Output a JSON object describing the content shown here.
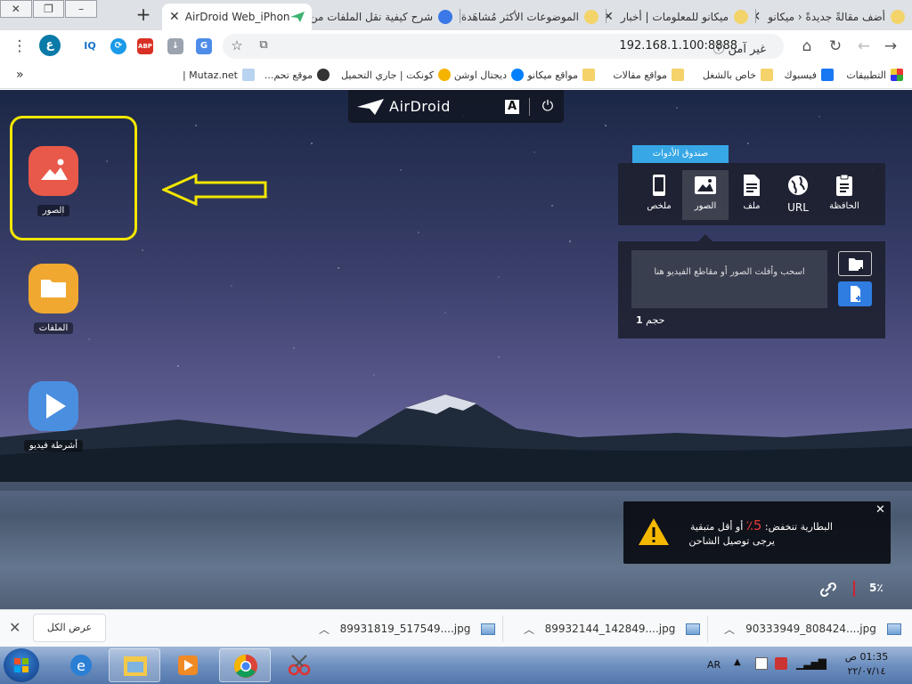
{
  "tabs": [
    {
      "title": "أضف مقالةً جديدةً ‹ ميكانو"
    },
    {
      "title": "ميكانو للمعلومات | أخبار"
    },
    {
      "title": "الموضوعات الأكثر مُشاهَدة"
    },
    {
      "title": "شرح كيفية نقل الملفات من"
    },
    {
      "title": "AirDroid Web_iPhone"
    }
  ],
  "toolbar": {
    "url": "192.168.1.100:8888",
    "security_label": "غير آمن",
    "ext_iq": "IQ",
    "ext_abp": "ABP",
    "ext_profile": "ع"
  },
  "bookmarks": {
    "more": "»",
    "items": [
      {
        "label": "التطبيقات"
      },
      {
        "label": "فيسبوك"
      },
      {
        "label": "خاص بالشغل"
      },
      {
        "label": "مواقع مقالات"
      },
      {
        "label": "مواقع ميكانو"
      },
      {
        "label": "ديجتال اوشن"
      },
      {
        "label": "كونكت | جاري التحميل"
      },
      {
        "label": "موقع تحم..."
      },
      {
        "label": "Mutaz.net |"
      }
    ]
  },
  "airdroid": {
    "brand": "AirDroid",
    "lang_button": "A",
    "apps": [
      {
        "label": "الصور",
        "color": "#e8594a"
      },
      {
        "label": "الملفات",
        "color": "#f0a830"
      },
      {
        "label": "أشرطة فيديو",
        "color": "#4a8ee0"
      }
    ],
    "toolbox": {
      "title": "صندوق الأدوات",
      "tools": [
        {
          "label": "ملخص"
        },
        {
          "label": "الصور"
        },
        {
          "label": "ملف"
        },
        {
          "label": "URL"
        },
        {
          "label": "الحافظة"
        }
      ],
      "drop_text": "اسحب وأفلت الصور أو مقاطع الفيديو هنا",
      "size_label": "حجم",
      "size_value": "1"
    },
    "battery": {
      "line1_prefix": "البطارية تنخفض:",
      "percent": "5٪",
      "line1_suffix": "أو أقل متبقية",
      "line2": "يرجى توصيل الشاحن"
    },
    "bottom_percent": "5٪"
  },
  "downloads": {
    "show_all": "عرض الكل",
    "items": [
      {
        "name": "90333949_808424....jpg"
      },
      {
        "name": "89932144_142849....jpg"
      },
      {
        "name": "89931819_517549....jpg"
      }
    ]
  },
  "taskbar": {
    "language": "AR",
    "time": "01:35 ص",
    "date": "٢٢/٠٧/١٤"
  }
}
